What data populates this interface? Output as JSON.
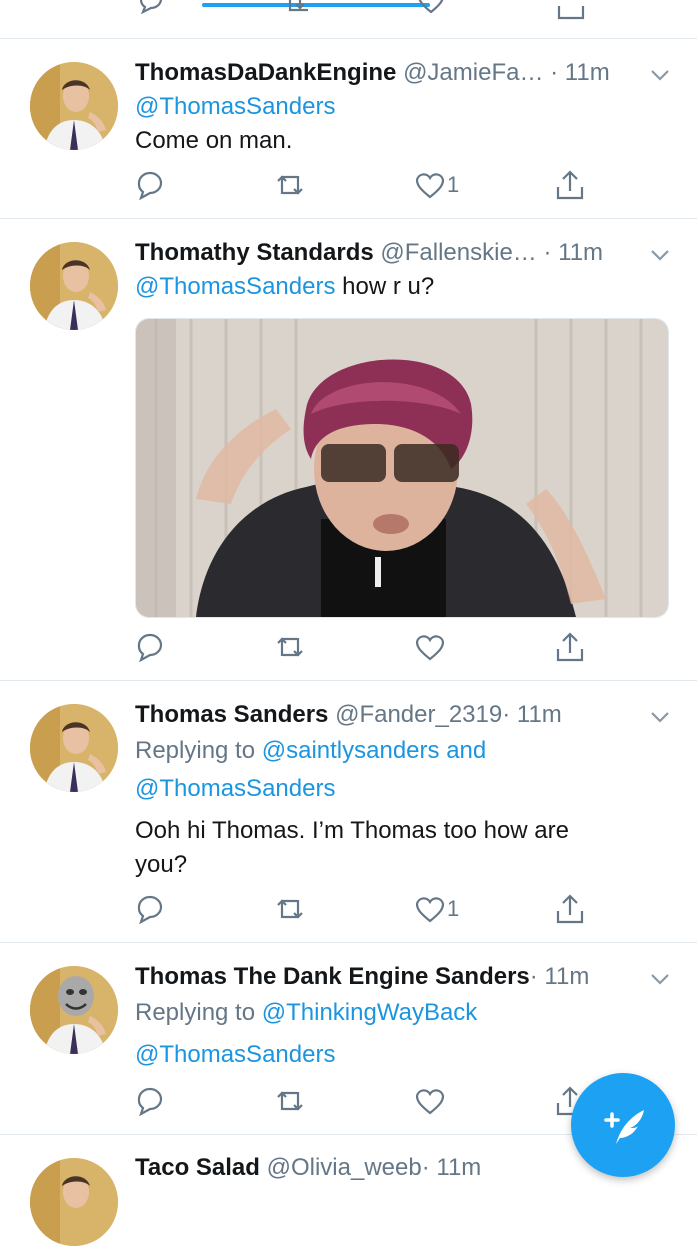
{
  "colors": {
    "accent": "#1b95e0",
    "text": "#14171a",
    "secondary": "#657786",
    "divider": "#e1e8ed",
    "fab": "#1da1f2"
  },
  "tweets": [
    {
      "name": "ThomasDaDankEngine",
      "handle": "@JamieFa…",
      "time": "· 11m",
      "mention_line": "@ThomasSanders",
      "body": "Come on man.",
      "likes": "1"
    },
    {
      "name": "Thomathy Standards",
      "handle": "@Fallenskie…",
      "time": "· 11m",
      "mention": "@ThomasSanders",
      "body": "how r u?",
      "media_alt": "video-thumbnail"
    },
    {
      "name": "Thomas Sanders",
      "handle": "@Fander_2319",
      "time": "· 11m",
      "replying_prefix": "Replying to",
      "replying_users": "@saintlysanders and",
      "replying_line2": "@ThomasSanders",
      "body_line1": "Ooh hi Thomas. I’m Thomas too how are",
      "body_line2": "you?",
      "likes": "1"
    },
    {
      "name": "Thomas The Dank Engine Sanders",
      "time": "· 11m",
      "replying_prefix": "Replying to",
      "replying_users": "@ThinkingWayBack",
      "mention_line": "@ThomasSanders"
    },
    {
      "name": "Taco Salad",
      "handle": "@Olivia_weeb",
      "time": "· 11m"
    }
  ],
  "icons": {
    "reply": "reply-icon",
    "retweet": "retweet-icon",
    "like": "heart-icon",
    "share": "share-icon",
    "more": "chevron-down-icon",
    "compose": "compose-tweet-icon"
  }
}
